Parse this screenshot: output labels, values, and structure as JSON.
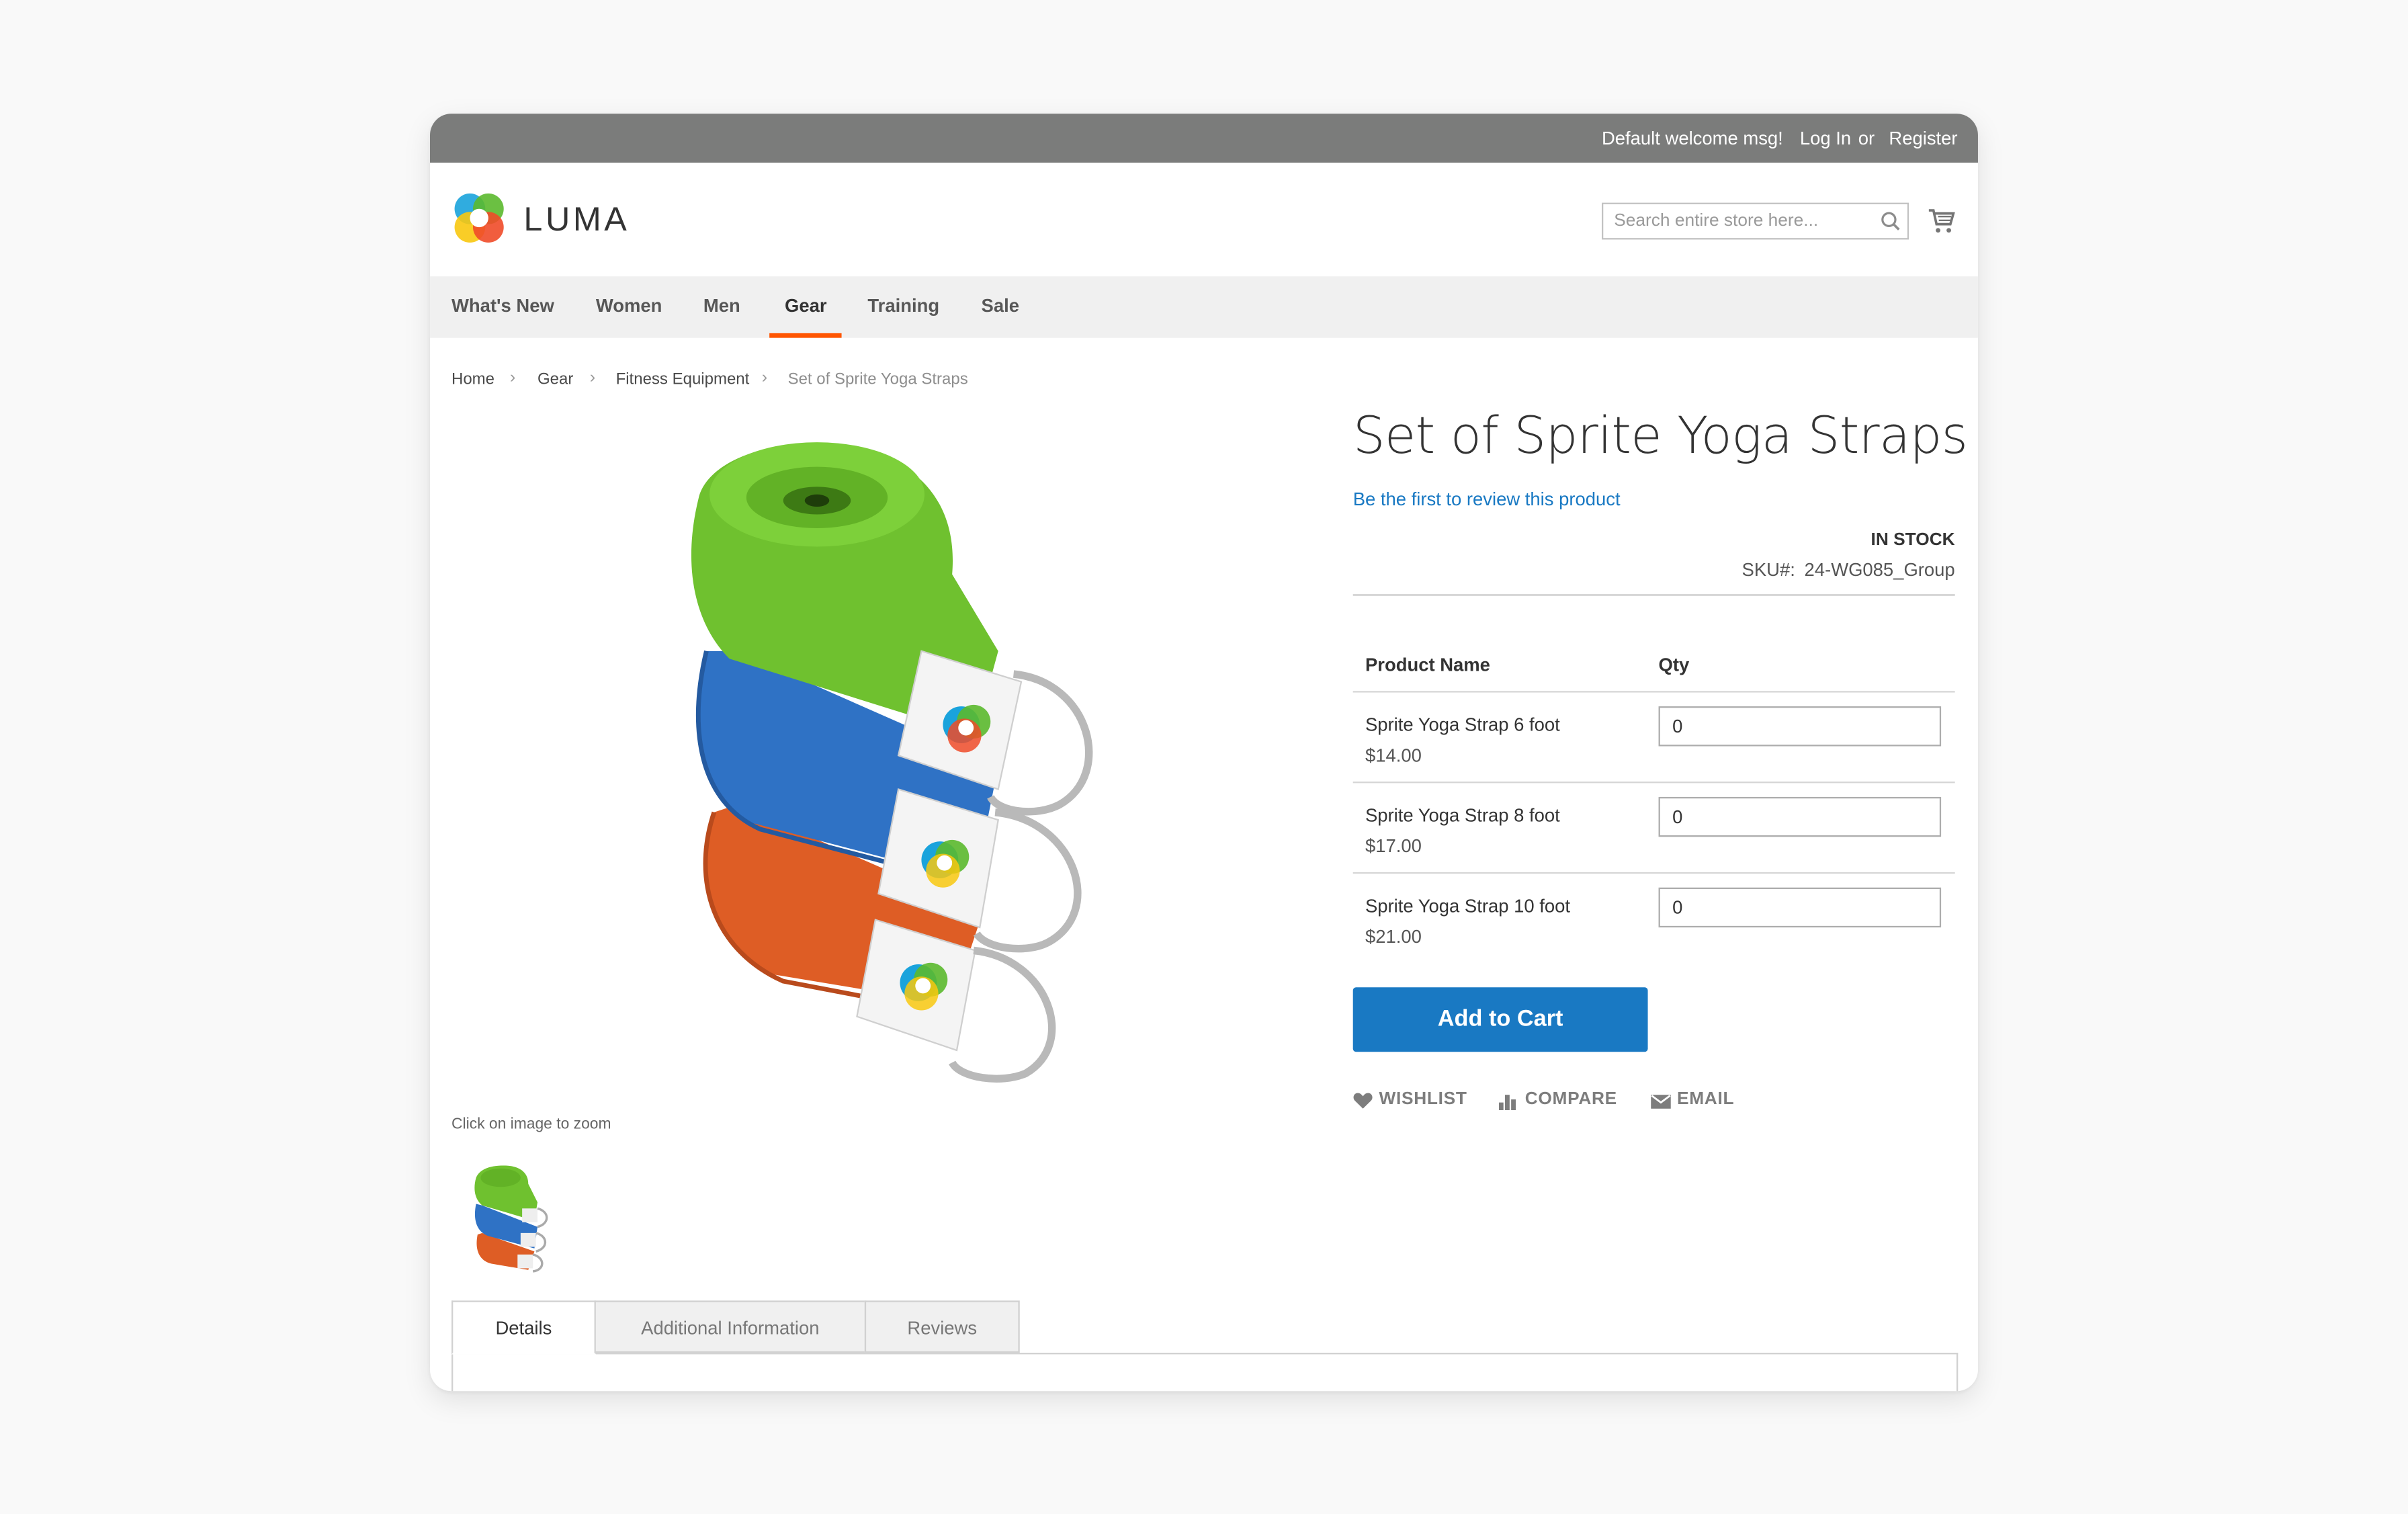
{
  "top_bar": {
    "welcome": "Default welcome msg!",
    "login": "Log In",
    "or": "or",
    "register": "Register"
  },
  "header": {
    "logo_text": "LUMA",
    "search_placeholder": "Search entire store here..."
  },
  "nav": {
    "items": [
      "What's New",
      "Women",
      "Men",
      "Gear",
      "Training",
      "Sale"
    ],
    "active": "Gear"
  },
  "breadcrumb": [
    "Home",
    "Gear",
    "Fitness Equipment",
    "Set of Sprite Yoga Straps"
  ],
  "gallery": {
    "zoom_hint": "Click on image to zoom"
  },
  "product": {
    "title": "Set of Sprite Yoga Straps",
    "review_link": "Be the first to review this product",
    "stock": "IN STOCK",
    "sku_label": "SKU#:",
    "sku": "24-WG085_Group",
    "table_headers": {
      "name": "Product Name",
      "qty": "Qty"
    },
    "items": [
      {
        "name": "Sprite Yoga Strap 6 foot",
        "price": "$14.00",
        "qty": "0"
      },
      {
        "name": "Sprite Yoga Strap 8 foot",
        "price": "$17.00",
        "qty": "0"
      },
      {
        "name": "Sprite Yoga Strap 10 foot",
        "price": "$21.00",
        "qty": "0"
      }
    ],
    "add_to_cart": "Add to Cart",
    "actions": {
      "wishlist": "WISHLIST",
      "compare": "COMPARE",
      "email": "EMAIL"
    }
  },
  "tabs": [
    "Details",
    "Additional Information",
    "Reviews"
  ],
  "colors": {
    "accent": "#1979c3",
    "nav_underline": "#ff5501",
    "top_bar": "#7b7c7b"
  },
  "icons": [
    "logo-icon",
    "search-icon",
    "cart-icon",
    "heart-icon",
    "compare-icon",
    "envelope-icon"
  ]
}
